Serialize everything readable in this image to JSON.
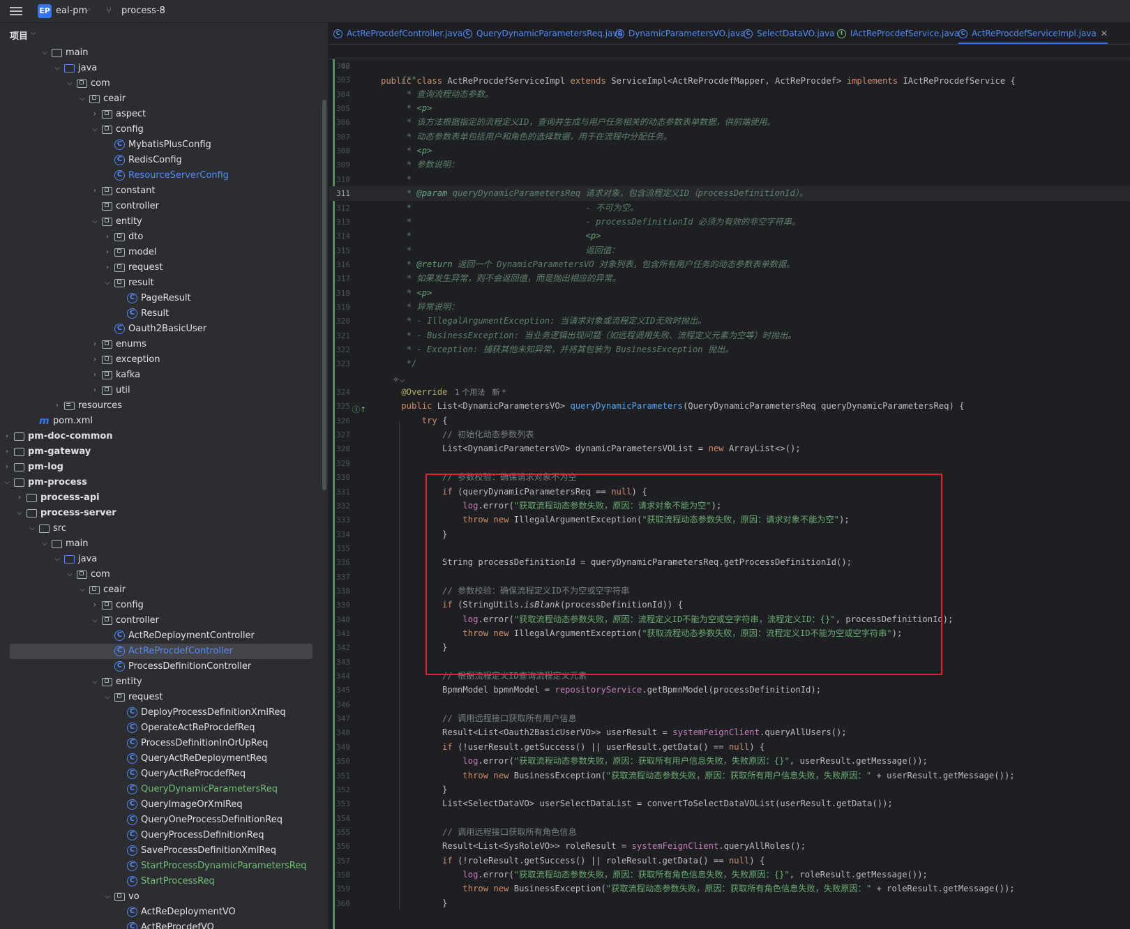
{
  "topbar": {
    "project_badge": "EP",
    "project_name": "eal-pm",
    "branch": "process-8"
  },
  "panel": {
    "title": "项目"
  },
  "tree": [
    {
      "label": "main",
      "indent": 4,
      "arrow": "v",
      "icon": "folder"
    },
    {
      "label": "java",
      "indent": 5,
      "arrow": "v",
      "icon": "folder-blue"
    },
    {
      "label": "com",
      "indent": 6,
      "arrow": "v",
      "icon": "package"
    },
    {
      "label": "ceair",
      "indent": 7,
      "arrow": "v",
      "icon": "package"
    },
    {
      "label": "aspect",
      "indent": 8,
      "arrow": ">",
      "icon": "package"
    },
    {
      "label": "config",
      "indent": 8,
      "arrow": "v",
      "icon": "package"
    },
    {
      "label": "MybatisPlusConfig",
      "indent": 9,
      "arrow": "",
      "icon": "class"
    },
    {
      "label": "RedisConfig",
      "indent": 9,
      "arrow": "",
      "icon": "class"
    },
    {
      "label": "ResourceServerConfig",
      "indent": 9,
      "arrow": "",
      "icon": "class",
      "color": "blue"
    },
    {
      "label": "constant",
      "indent": 8,
      "arrow": ">",
      "icon": "package"
    },
    {
      "label": "controller",
      "indent": 8,
      "arrow": "",
      "icon": "package"
    },
    {
      "label": "entity",
      "indent": 8,
      "arrow": "v",
      "icon": "package"
    },
    {
      "label": "dto",
      "indent": 9,
      "arrow": ">",
      "icon": "package"
    },
    {
      "label": "model",
      "indent": 9,
      "arrow": ">",
      "icon": "package"
    },
    {
      "label": "request",
      "indent": 9,
      "arrow": ">",
      "icon": "package"
    },
    {
      "label": "result",
      "indent": 9,
      "arrow": "v",
      "icon": "package"
    },
    {
      "label": "PageResult",
      "indent": 10,
      "arrow": "",
      "icon": "class"
    },
    {
      "label": "Result",
      "indent": 10,
      "arrow": "",
      "icon": "class"
    },
    {
      "label": "Oauth2BasicUser",
      "indent": 9,
      "arrow": "",
      "icon": "class"
    },
    {
      "label": "enums",
      "indent": 8,
      "arrow": ">",
      "icon": "package"
    },
    {
      "label": "exception",
      "indent": 8,
      "arrow": ">",
      "icon": "package"
    },
    {
      "label": "kafka",
      "indent": 8,
      "arrow": ">",
      "icon": "package"
    },
    {
      "label": "util",
      "indent": 8,
      "arrow": ">",
      "icon": "package"
    },
    {
      "label": "resources",
      "indent": 5,
      "arrow": ">",
      "icon": "resources"
    },
    {
      "label": "pom.xml",
      "indent": 3,
      "arrow": "",
      "icon": "maven"
    },
    {
      "label": "pm-doc-common",
      "indent": 1,
      "arrow": ">",
      "icon": "module",
      "bold": true
    },
    {
      "label": "pm-gateway",
      "indent": 1,
      "arrow": ">",
      "icon": "module",
      "bold": true
    },
    {
      "label": "pm-log",
      "indent": 1,
      "arrow": ">",
      "icon": "module",
      "bold": true
    },
    {
      "label": "pm-process",
      "indent": 1,
      "arrow": "v",
      "icon": "module",
      "bold": true
    },
    {
      "label": "process-api",
      "indent": 2,
      "arrow": ">",
      "icon": "module",
      "bold": true
    },
    {
      "label": "process-server",
      "indent": 2,
      "arrow": "v",
      "icon": "module",
      "bold": true
    },
    {
      "label": "src",
      "indent": 3,
      "arrow": "v",
      "icon": "folder"
    },
    {
      "label": "main",
      "indent": 4,
      "arrow": "v",
      "icon": "folder"
    },
    {
      "label": "java",
      "indent": 5,
      "arrow": "v",
      "icon": "folder-blue"
    },
    {
      "label": "com",
      "indent": 6,
      "arrow": "v",
      "icon": "package"
    },
    {
      "label": "ceair",
      "indent": 7,
      "arrow": "v",
      "icon": "package"
    },
    {
      "label": "config",
      "indent": 8,
      "arrow": ">",
      "icon": "package"
    },
    {
      "label": "controller",
      "indent": 8,
      "arrow": "v",
      "icon": "package"
    },
    {
      "label": "ActReDeploymentController",
      "indent": 9,
      "arrow": "",
      "icon": "class"
    },
    {
      "label": "ActReProcdefController",
      "indent": 9,
      "arrow": "",
      "icon": "class",
      "color": "blue",
      "selected": true
    },
    {
      "label": "ProcessDefinitionController",
      "indent": 9,
      "arrow": "",
      "icon": "class"
    },
    {
      "label": "entity",
      "indent": 8,
      "arrow": "v",
      "icon": "package"
    },
    {
      "label": "request",
      "indent": 9,
      "arrow": "v",
      "icon": "package"
    },
    {
      "label": "DeployProcessDefinitionXmlReq",
      "indent": 10,
      "arrow": "",
      "icon": "class"
    },
    {
      "label": "OperateActReProcdefReq",
      "indent": 10,
      "arrow": "",
      "icon": "class"
    },
    {
      "label": "ProcessDefinitionInOrUpReq",
      "indent": 10,
      "arrow": "",
      "icon": "class"
    },
    {
      "label": "QueryActReDeploymentReq",
      "indent": 10,
      "arrow": "",
      "icon": "class"
    },
    {
      "label": "QueryActReProcdefReq",
      "indent": 10,
      "arrow": "",
      "icon": "class"
    },
    {
      "label": "QueryDynamicParametersReq",
      "indent": 10,
      "arrow": "",
      "icon": "class",
      "color": "green"
    },
    {
      "label": "QueryImageOrXmlReq",
      "indent": 10,
      "arrow": "",
      "icon": "class"
    },
    {
      "label": "QueryOneProcessDefinitionReq",
      "indent": 10,
      "arrow": "",
      "icon": "class"
    },
    {
      "label": "QueryProcessDefinitionReq",
      "indent": 10,
      "arrow": "",
      "icon": "class"
    },
    {
      "label": "SaveProcessDefinitionXmlReq",
      "indent": 10,
      "arrow": "",
      "icon": "class"
    },
    {
      "label": "StartProcessDynamicParametersReq",
      "indent": 10,
      "arrow": "",
      "icon": "class",
      "color": "green"
    },
    {
      "label": "StartProcessReq",
      "indent": 10,
      "arrow": "",
      "icon": "class",
      "color": "green"
    },
    {
      "label": "vo",
      "indent": 9,
      "arrow": "v",
      "icon": "package"
    },
    {
      "label": "ActReDeploymentVO",
      "indent": 10,
      "arrow": "",
      "icon": "class"
    },
    {
      "label": "ActReProcdefVO",
      "indent": 10,
      "arrow": "",
      "icon": "class"
    }
  ],
  "tabs": [
    {
      "label": "ActReProcdefController.java",
      "icon": "class"
    },
    {
      "label": "QueryDynamicParametersReq.java",
      "icon": "class"
    },
    {
      "label": "DynamicParametersVO.java",
      "icon": "class"
    },
    {
      "label": "SelectDataVO.java",
      "icon": "class"
    },
    {
      "label": "IActReProcdefService.java",
      "icon": "interface"
    },
    {
      "label": "ActReProcdefServiceImpl.java",
      "icon": "class",
      "active": true
    }
  ],
  "sticky": {
    "line_no": "46",
    "tokens": [
      [
        "kw",
        "public class "
      ],
      [
        "pl",
        "ActReProcdefServiceImpl "
      ],
      [
        "kw",
        "extends "
      ],
      [
        "pl",
        "ServiceImpl<ActReProcdefMapper, ActReProcdef> "
      ],
      [
        "kw",
        "implements "
      ],
      [
        "pl",
        "IActReProcdefService {"
      ]
    ]
  },
  "inlay": {
    "usages": "1 个用法",
    "new": "新 *"
  },
  "code_lines": [
    {
      "n": "302",
      "t": []
    },
    {
      "n": "303",
      "t": [
        [
          "doc",
          "    /**"
        ]
      ]
    },
    {
      "n": "304",
      "t": [
        [
          "doc",
          "     * 查询流程动态参数。"
        ]
      ]
    },
    {
      "n": "305",
      "t": [
        [
          "doc",
          "     * "
        ],
        [
          "tag",
          "<p>"
        ]
      ]
    },
    {
      "n": "306",
      "t": [
        [
          "doc",
          "     * 该方法根据指定的流程定义ID，查询并生成与用户任务相关的动态参数表单数据，供前端使用。"
        ]
      ]
    },
    {
      "n": "307",
      "t": [
        [
          "doc",
          "     * 动态参数表单包括用户和角色的选择数据，用于在流程中分配任务。"
        ]
      ]
    },
    {
      "n": "308",
      "t": [
        [
          "doc",
          "     * "
        ],
        [
          "tag",
          "<p>"
        ]
      ]
    },
    {
      "n": "309",
      "t": [
        [
          "doc",
          "     * 参数说明："
        ]
      ]
    },
    {
      "n": "310",
      "t": [
        [
          "doc",
          "     *"
        ]
      ]
    },
    {
      "n": "311",
      "hl": true,
      "t": [
        [
          "doc",
          "     * "
        ],
        [
          "tag",
          "@param "
        ],
        [
          "doc",
          "queryDynamicParametersReq 请求对象，包含流程定义ID（processDefinitionId）。"
        ]
      ]
    },
    {
      "n": "312",
      "t": [
        [
          "doc",
          "     *                                  - 不可为空。"
        ]
      ]
    },
    {
      "n": "313",
      "t": [
        [
          "doc",
          "     *                                  - processDefinitionId 必须为有效的非空字符串。"
        ]
      ]
    },
    {
      "n": "314",
      "t": [
        [
          "doc",
          "     *                                  "
        ],
        [
          "tag",
          "<p>"
        ]
      ]
    },
    {
      "n": "315",
      "t": [
        [
          "doc",
          "     *                                  返回值："
        ]
      ]
    },
    {
      "n": "316",
      "t": [
        [
          "doc",
          "     * "
        ],
        [
          "tag",
          "@return "
        ],
        [
          "doc",
          "返回一个 DynamicParametersVO 对象列表，包含所有用户任务的动态参数表单数据。"
        ]
      ]
    },
    {
      "n": "317",
      "t": [
        [
          "doc",
          "     * 如果发生异常，则不会返回值，而是抛出相应的异常。"
        ]
      ]
    },
    {
      "n": "318",
      "t": [
        [
          "doc",
          "     * "
        ],
        [
          "tag",
          "<p>"
        ]
      ]
    },
    {
      "n": "319",
      "t": [
        [
          "doc",
          "     * 异常说明："
        ]
      ]
    },
    {
      "n": "320",
      "t": [
        [
          "doc",
          "     * - IllegalArgumentException: 当请求对象或流程定义ID无效时抛出。"
        ]
      ]
    },
    {
      "n": "321",
      "t": [
        [
          "doc",
          "     * - BusinessException: 当业务逻辑出现问题（如远程调用失败、流程定义元素为空等）时抛出。"
        ]
      ]
    },
    {
      "n": "322",
      "t": [
        [
          "doc",
          "     * - Exception: 捕获其他未知异常，并将其包装为 BusinessException 抛出。"
        ]
      ]
    },
    {
      "n": "323",
      "t": [
        [
          "doc",
          "     */"
        ]
      ]
    },
    {
      "n": "",
      "t": []
    },
    {
      "n": "324",
      "t": [
        [
          "ann",
          "    @Override"
        ]
      ],
      "inlay": true
    },
    {
      "n": "325",
      "t": [
        [
          "kw",
          "    public "
        ],
        [
          "pl",
          "List<DynamicParametersVO> "
        ],
        [
          "fn",
          "queryDynamicParameters"
        ],
        [
          "pl",
          "(QueryDynamicParametersReq queryDynamicParametersReq) {"
        ]
      ]
    },
    {
      "n": "326",
      "t": [
        [
          "kw",
          "        try "
        ],
        [
          "pl",
          "{"
        ]
      ]
    },
    {
      "n": "327",
      "t": [
        [
          "cm",
          "            // 初始化动态参数列表"
        ]
      ]
    },
    {
      "n": "328",
      "t": [
        [
          "pl",
          "            List<DynamicParametersVO> dynamicParametersVOList = "
        ],
        [
          "kw",
          "new "
        ],
        [
          "pl",
          "ArrayList<>();"
        ]
      ]
    },
    {
      "n": "329",
      "t": []
    },
    {
      "n": "330",
      "t": [
        [
          "cm",
          "            // 参数校验：确保请求对象不为空"
        ]
      ]
    },
    {
      "n": "331",
      "t": [
        [
          "kw",
          "            if "
        ],
        [
          "pl",
          "(queryDynamicParametersReq == "
        ],
        [
          "kw",
          "null"
        ],
        [
          "pl",
          ") {"
        ]
      ]
    },
    {
      "n": "332",
      "t": [
        [
          "fld",
          "                log"
        ],
        [
          "pl",
          ".error("
        ],
        [
          "str",
          "\"获取流程动态参数失败，原因：请求对象不能为空\""
        ],
        [
          "pl",
          ");"
        ]
      ]
    },
    {
      "n": "333",
      "t": [
        [
          "kw",
          "                throw new "
        ],
        [
          "pl",
          "IllegalArgumentException("
        ],
        [
          "str",
          "\"获取流程动态参数失败，原因：请求对象不能为空\""
        ],
        [
          "pl",
          ");"
        ]
      ]
    },
    {
      "n": "334",
      "t": [
        [
          "pl",
          "            }"
        ]
      ]
    },
    {
      "n": "335",
      "t": []
    },
    {
      "n": "336",
      "t": [
        [
          "pl",
          "            String processDefinitionId = queryDynamicParametersReq.getProcessDefinitionId();"
        ]
      ]
    },
    {
      "n": "337",
      "t": []
    },
    {
      "n": "338",
      "t": [
        [
          "cm",
          "            // 参数校验：确保流程定义ID不为空或空字符串"
        ]
      ]
    },
    {
      "n": "339",
      "t": [
        [
          "kw",
          "            if "
        ],
        [
          "pl",
          "(StringUtils."
        ],
        [
          "stat",
          "isBlank"
        ],
        [
          "pl",
          "(processDefinitionId)) {"
        ]
      ]
    },
    {
      "n": "340",
      "t": [
        [
          "fld",
          "                log"
        ],
        [
          "pl",
          ".error("
        ],
        [
          "str",
          "\"获取流程动态参数失败，原因：流程定义ID不能为空或空字符串，流程定义ID：{}\""
        ],
        [
          "pl",
          ", processDefinitionId);"
        ]
      ]
    },
    {
      "n": "341",
      "t": [
        [
          "kw",
          "                throw new "
        ],
        [
          "pl",
          "IllegalArgumentException("
        ],
        [
          "str",
          "\"获取流程动态参数失败，原因：流程定义ID不能为空或空字符串\""
        ],
        [
          "pl",
          ");"
        ]
      ]
    },
    {
      "n": "342",
      "t": [
        [
          "pl",
          "            }"
        ]
      ]
    },
    {
      "n": "343",
      "t": []
    },
    {
      "n": "344",
      "t": [
        [
          "cm",
          "            // 根据流程定义ID查询流程定义元素"
        ]
      ]
    },
    {
      "n": "345",
      "t": [
        [
          "pl",
          "            BpmnModel bpmnModel = "
        ],
        [
          "fld",
          "repositoryService"
        ],
        [
          "pl",
          ".getBpmnModel(processDefinitionId);"
        ]
      ]
    },
    {
      "n": "346",
      "t": []
    },
    {
      "n": "347",
      "t": [
        [
          "cm",
          "            // 调用远程接口获取所有用户信息"
        ]
      ]
    },
    {
      "n": "348",
      "t": [
        [
          "pl",
          "            Result<List<Oauth2BasicUserVO>> userResult = "
        ],
        [
          "fld",
          "systemFeignClient"
        ],
        [
          "pl",
          ".queryAllUsers();"
        ]
      ]
    },
    {
      "n": "349",
      "t": [
        [
          "kw",
          "            if "
        ],
        [
          "pl",
          "(!userResult.getSuccess() || userResult.getData() == "
        ],
        [
          "kw",
          "null"
        ],
        [
          "pl",
          ") {"
        ]
      ]
    },
    {
      "n": "350",
      "t": [
        [
          "fld",
          "                log"
        ],
        [
          "pl",
          ".error("
        ],
        [
          "str",
          "\"获取流程动态参数失败，原因：获取所有用户信息失败，失败原因：{}\""
        ],
        [
          "pl",
          ", userResult.getMessage());"
        ]
      ]
    },
    {
      "n": "351",
      "t": [
        [
          "kw",
          "                throw new "
        ],
        [
          "pl",
          "BusinessException("
        ],
        [
          "str",
          "\"获取流程动态参数失败，原因：获取所有用户信息失败，失败原因：\""
        ],
        [
          "pl",
          " + userResult.getMessage());"
        ]
      ]
    },
    {
      "n": "352",
      "t": [
        [
          "pl",
          "            }"
        ]
      ]
    },
    {
      "n": "353",
      "t": [
        [
          "pl",
          "            List<SelectDataVO> userSelectDataList = convertToSelectDataVOList(userResult.getData());"
        ]
      ]
    },
    {
      "n": "354",
      "t": []
    },
    {
      "n": "355",
      "t": [
        [
          "cm",
          "            // 调用远程接口获取所有角色信息"
        ]
      ]
    },
    {
      "n": "356",
      "t": [
        [
          "pl",
          "            Result<List<SysRoleVO>> roleResult = "
        ],
        [
          "fld",
          "systemFeignClient"
        ],
        [
          "pl",
          ".queryAllRoles();"
        ]
      ]
    },
    {
      "n": "357",
      "t": [
        [
          "kw",
          "            if "
        ],
        [
          "pl",
          "(!roleResult.getSuccess() || roleResult.getData() == "
        ],
        [
          "kw",
          "null"
        ],
        [
          "pl",
          ") {"
        ]
      ]
    },
    {
      "n": "358",
      "t": [
        [
          "fld",
          "                log"
        ],
        [
          "pl",
          ".error("
        ],
        [
          "str",
          "\"获取流程动态参数失败，原因：获取所有角色信息失败，失败原因：{}\""
        ],
        [
          "pl",
          ", roleResult.getMessage());"
        ]
      ]
    },
    {
      "n": "359",
      "t": [
        [
          "kw",
          "                throw new "
        ],
        [
          "pl",
          "BusinessException("
        ],
        [
          "str",
          "\"获取流程动态参数失败，原因：获取所有角色信息失败，失败原因：\""
        ],
        [
          "pl",
          " + roleResult.getMessage());"
        ]
      ]
    },
    {
      "n": "360",
      "t": [
        [
          "pl",
          "            }"
        ]
      ]
    }
  ]
}
